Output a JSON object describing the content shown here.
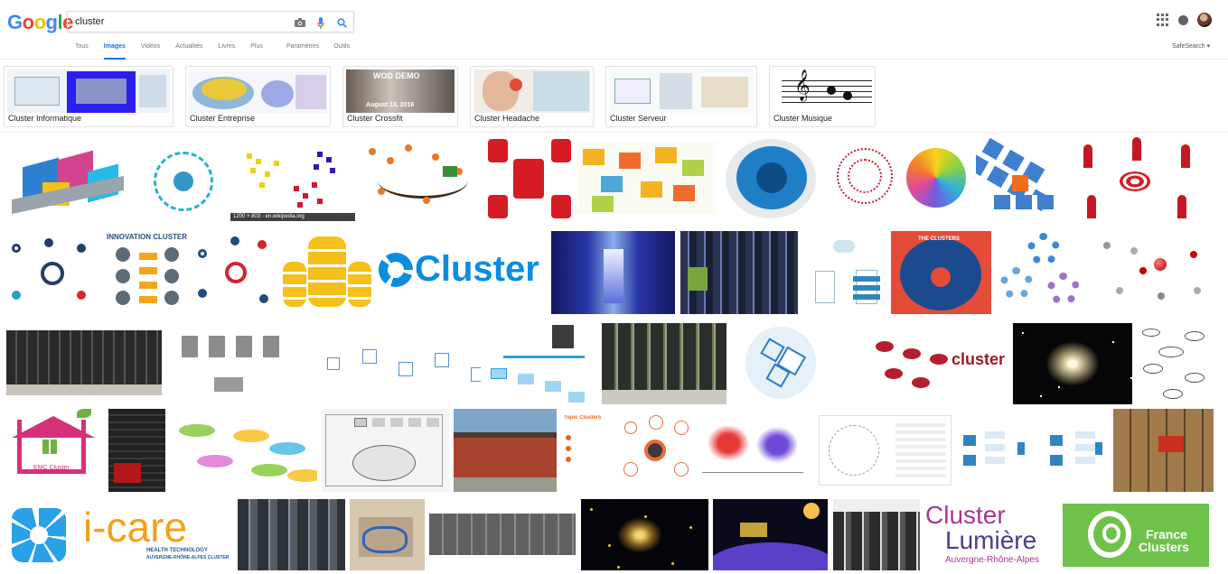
{
  "search": {
    "query": "cluster"
  },
  "tabs": [
    "Tous",
    "Images",
    "Vidéos",
    "Actualités",
    "Livres",
    "Plus"
  ],
  "active_tab": "Images",
  "tools": [
    "Paramètres",
    "Outils"
  ],
  "safesearch": "SafeSearch ▾",
  "related": [
    {
      "label": "Cluster Informatique"
    },
    {
      "label": "Cluster Entreprise"
    },
    {
      "label": "Cluster Crossfit",
      "overlay": "WOD DEMO"
    },
    {
      "label": "Cluster Headache"
    },
    {
      "label": "Cluster Serveur"
    },
    {
      "label": "Cluster Musique"
    }
  ],
  "caption": "1200 × 803 - en.wikipedia.org",
  "tile_texts": {
    "cluster_logo": "Cluster",
    "innovation": "INNOVATION CLUSTER",
    "cluster_red": "cluster",
    "emc": "EMC Cluster",
    "icare": "i-care",
    "icare_sub": "HEALTH TECHNOLOGY",
    "icare_sub2": "AUVERGNE-RHÔNE-ALPES CLUSTER",
    "lumiere1": "Cluster",
    "lumiere2": "Lumière",
    "lumiere3": "Auvergne-Rhône-Alpes",
    "france1": "France",
    "france2": "Clusters",
    "topic": "Topic Clusters",
    "the_clusters": "THE CLUSTERS",
    "crossfit_date": "August 13, 2016"
  }
}
